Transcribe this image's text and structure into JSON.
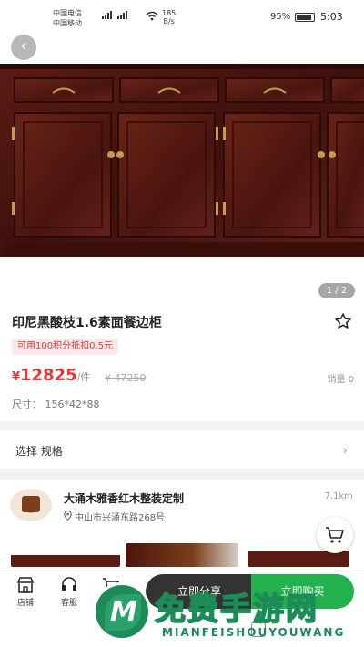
{
  "status_bar": {
    "carrier_1": "中国电信",
    "carrier_2": "中国移动",
    "hd": "HD",
    "net_speed": "185",
    "net_unit": "B/s",
    "battery": "95%",
    "time": "5:03"
  },
  "gallery": {
    "page_indicator": "1 / 2"
  },
  "product": {
    "title": "印尼黑酸枝1.6素面餐边柜",
    "coupon": "可用100积分抵扣0.5元",
    "currency": "¥",
    "price": "12825",
    "unit": "/件",
    "old_price": "¥ 47250",
    "sales": "销量 0",
    "size": "尺寸：  156*42*88"
  },
  "spec": {
    "label": "选择  规格"
  },
  "store": {
    "name": "大涌木雅香红木整装定制",
    "distance": "7.1km",
    "address": "中山市兴涌东路268号"
  },
  "bottom_bar": {
    "store_label": "店铺",
    "service_label": "客服",
    "cart_label": "加",
    "share_label": "立即分享",
    "buy_label": "立即购买"
  },
  "watermark": {
    "cn": "免费手游网",
    "en": "MIANFEISHOUYOUWANG"
  },
  "colors": {
    "price_red": "#e53935",
    "buy_green": "#22b14c",
    "share_dark": "#333333"
  }
}
